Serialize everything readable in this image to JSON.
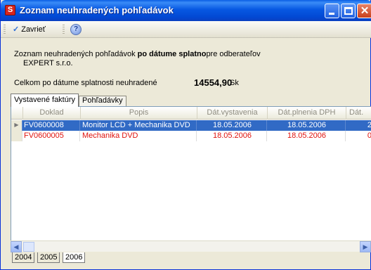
{
  "window": {
    "title": "Zoznam neuhradených pohľadávok",
    "icon_name": "app-red-icon"
  },
  "toolbar": {
    "close_label": "Zavrieť",
    "help_icon": "help-icon"
  },
  "info": {
    "line1_prefix": "Zoznam neuhradených  pohľadávok ",
    "line1_bold": "po dátume splatno",
    "line1_suffix": "pre odberateľov",
    "line2": "EXPERT s.r.o.",
    "total_label": "Celkom po dátume splatnosti neuhradené",
    "total_value": "14554,90",
    "currency": "Sk"
  },
  "tabs": [
    {
      "label": "Vystavené faktúry"
    },
    {
      "label": "Pohľadávky"
    }
  ],
  "grid": {
    "columns": [
      "Doklad",
      "Popis",
      "Dát.vystavenia",
      "Dát.plnenia DPH",
      "Dát."
    ],
    "rows": [
      {
        "doklad": "FV0600008",
        "popis": "Monitor LCD + Mechanika DVD",
        "dat_vyst": "18.05.2006",
        "dat_dph": "18.05.2006",
        "dat": "2"
      },
      {
        "doklad": "FV0600005",
        "popis": "Mechanika DVD",
        "dat_vyst": "18.05.2006",
        "dat_dph": "18.05.2006",
        "dat": "0"
      }
    ]
  },
  "sheet_tabs": [
    "2004",
    "2005",
    "2006"
  ],
  "colors": {
    "selection": "#316ac5",
    "overdue_text": "#e0120c",
    "title_bar": "#0758e2"
  }
}
